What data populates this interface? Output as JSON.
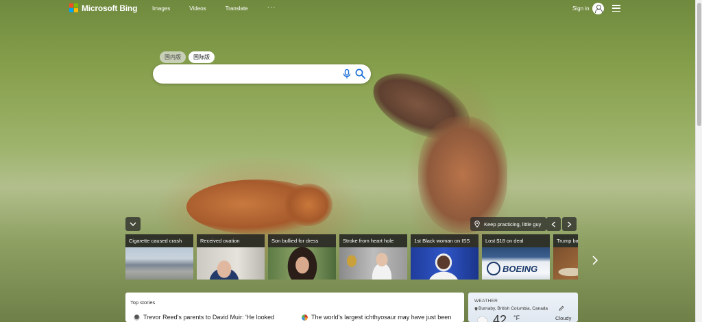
{
  "header": {
    "brand": "Microsoft Bing",
    "nav": [
      "Images",
      "Videos",
      "Translate"
    ],
    "more": "···",
    "signin_label": "Sign in"
  },
  "search": {
    "region_tabs": [
      {
        "label": "国内版",
        "active": false
      },
      {
        "label": "国际版",
        "active": true
      }
    ],
    "value": "",
    "placeholder": ""
  },
  "image_caption": "Keep practicing, little guy",
  "carousel": {
    "cards": [
      {
        "title": "Cigarette caused crash",
        "icon": "airport-planes-photo"
      },
      {
        "title": "Received ovation",
        "icon": "man-at-podium-photo"
      },
      {
        "title": "Son bullied for dress",
        "icon": "woman-portrait-photo"
      },
      {
        "title": "Stroke from heart hole",
        "icon": "woman-with-trophy-photo"
      },
      {
        "title": "1st Black woman on ISS",
        "icon": "astronaut-photo"
      },
      {
        "title": "Lost $18 on deal",
        "icon": "boeing-plane-photo"
      },
      {
        "title": "Trump back",
        "icon": "fossil-photo"
      }
    ]
  },
  "top_stories": {
    "heading": "Top stories",
    "items": [
      {
        "text": "Trevor Reed's parents to David Muir: 'He looked"
      },
      {
        "text": "The world's largest ichthyosaur may have just been"
      }
    ]
  },
  "weather": {
    "heading": "WEATHER",
    "location": "Burnaby, British Columbia, Canada",
    "temperature": "42",
    "unit": "°F",
    "condition": "Cloudy"
  },
  "colors": {
    "logo_red": "#f25022",
    "logo_green": "#7fba00",
    "logo_blue": "#00a4ef",
    "logo_yellow": "#ffb900",
    "search_accent": "#1a6ed8"
  }
}
